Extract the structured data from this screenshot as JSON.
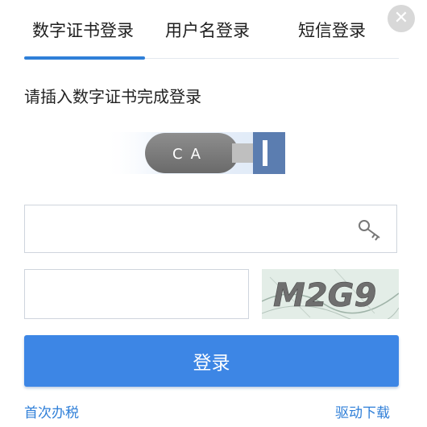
{
  "tabs": [
    {
      "label": "数字证书登录",
      "active": true
    },
    {
      "label": "用户名登录",
      "active": false
    },
    {
      "label": "短信登录",
      "active": false
    }
  ],
  "close": {
    "icon": "close-icon",
    "symbol": "✕"
  },
  "instruction": "请插入数字证书完成登录",
  "usb": {
    "label": "CA",
    "icon": "usb-key-icon"
  },
  "cert_input": {
    "value": "",
    "placeholder": "",
    "icon": "key-icon"
  },
  "captcha_input": {
    "value": "",
    "placeholder": ""
  },
  "captcha": {
    "text": "M2G9"
  },
  "login_button": {
    "label": "登录"
  },
  "links": {
    "first_time": "首次办税",
    "driver_download": "驱动下载"
  },
  "colors": {
    "accent": "#3d86e5",
    "link": "#2f7fd8",
    "tab_active": "#2f7fd8",
    "usb_body": "#7a7a7a",
    "usb_connector": "#5b7db0"
  }
}
